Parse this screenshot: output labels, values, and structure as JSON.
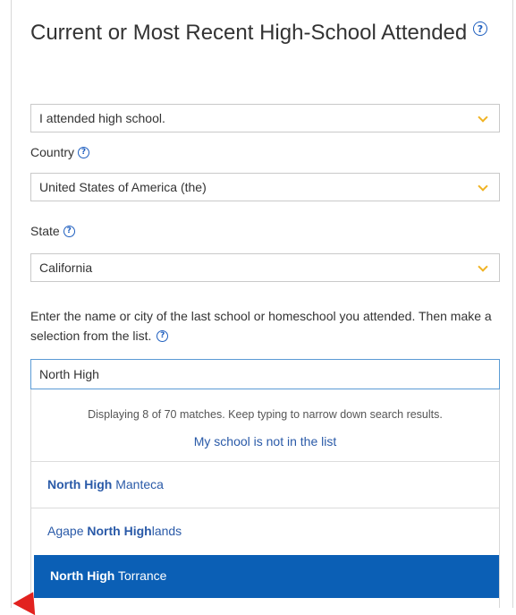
{
  "section": {
    "title": "Current or Most Recent High-School Attended",
    "help_glyph": "?"
  },
  "attendance_select": {
    "value": "I attended high school."
  },
  "country": {
    "label": "Country",
    "value": "United States of America (the)"
  },
  "state": {
    "label": "State",
    "value": "California"
  },
  "school_search": {
    "prompt": "Enter the name or city of the last school or homeschool you attended. Then make a selection from the list.",
    "value": "North High"
  },
  "results": {
    "info": "Displaying 8 of 70 matches. Keep typing to narrow down search results.",
    "not_in_list": "My school is not in the list",
    "options": [
      {
        "prefix": "",
        "match": "North High",
        "suffix": " Manteca"
      },
      {
        "prefix": "Agape ",
        "match": "North High",
        "suffix": "lands"
      },
      {
        "prefix": "",
        "match": "North High",
        "suffix": " Torrance"
      }
    ]
  },
  "colors": {
    "accent": "#0b5fb5",
    "link": "#2a5aa8",
    "chevron": "#f0b323",
    "pointer": "#e2221f"
  }
}
